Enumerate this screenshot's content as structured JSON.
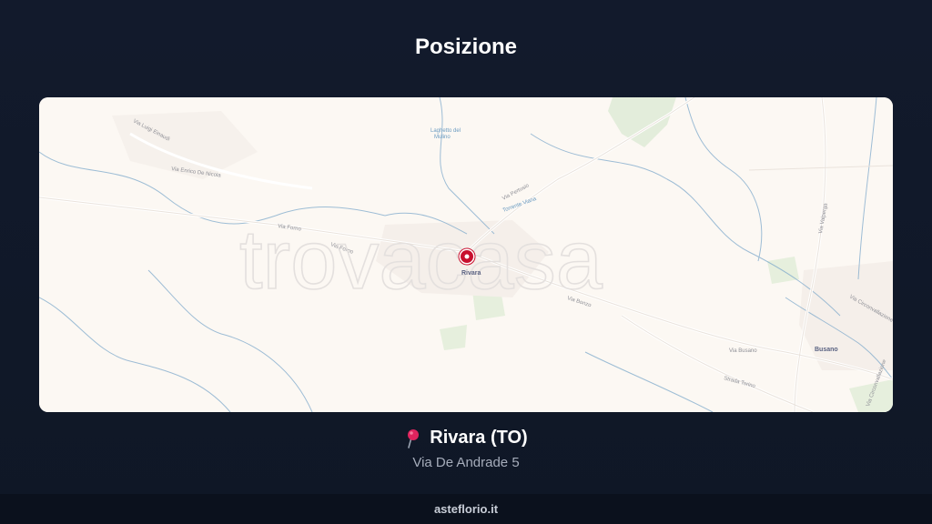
{
  "header": {
    "title": "Posizione"
  },
  "map": {
    "watermark": "trovacasa",
    "marker_label": "Rivara",
    "labels": {
      "via_luigi_einaudi": "Via Luigi Einaudi",
      "via_enrico_de_nicola": "Via Enrico De Nicola",
      "laghetto": "Laghetto del",
      "mulino": "Mulino",
      "via_forno_1": "Via Forno",
      "via_forno_2": "Via Forno",
      "via_bonzo": "Via Bonzo",
      "via_busano": "Via Busano",
      "via_valperga": "Via Valperga",
      "via_circonvallazione": "Via Circonvallazione",
      "via_circonvallazione_2": "Via Circonvallazione",
      "busano": "Busano",
      "strada_torino": "Strada Torino",
      "via_pertusio": "Via Pertusio",
      "torrente_viana": "Torrente Viana"
    },
    "colors": {
      "land": "#fcf8f3",
      "park": "#dfead6",
      "water": "#7ea9cb",
      "marker": "#c8102e"
    }
  },
  "location": {
    "pin_icon": "round-pushpin",
    "name": "Rivara (TO)",
    "address": "Via De Andrade 5"
  },
  "footer": {
    "site": "asteflorio.it"
  }
}
